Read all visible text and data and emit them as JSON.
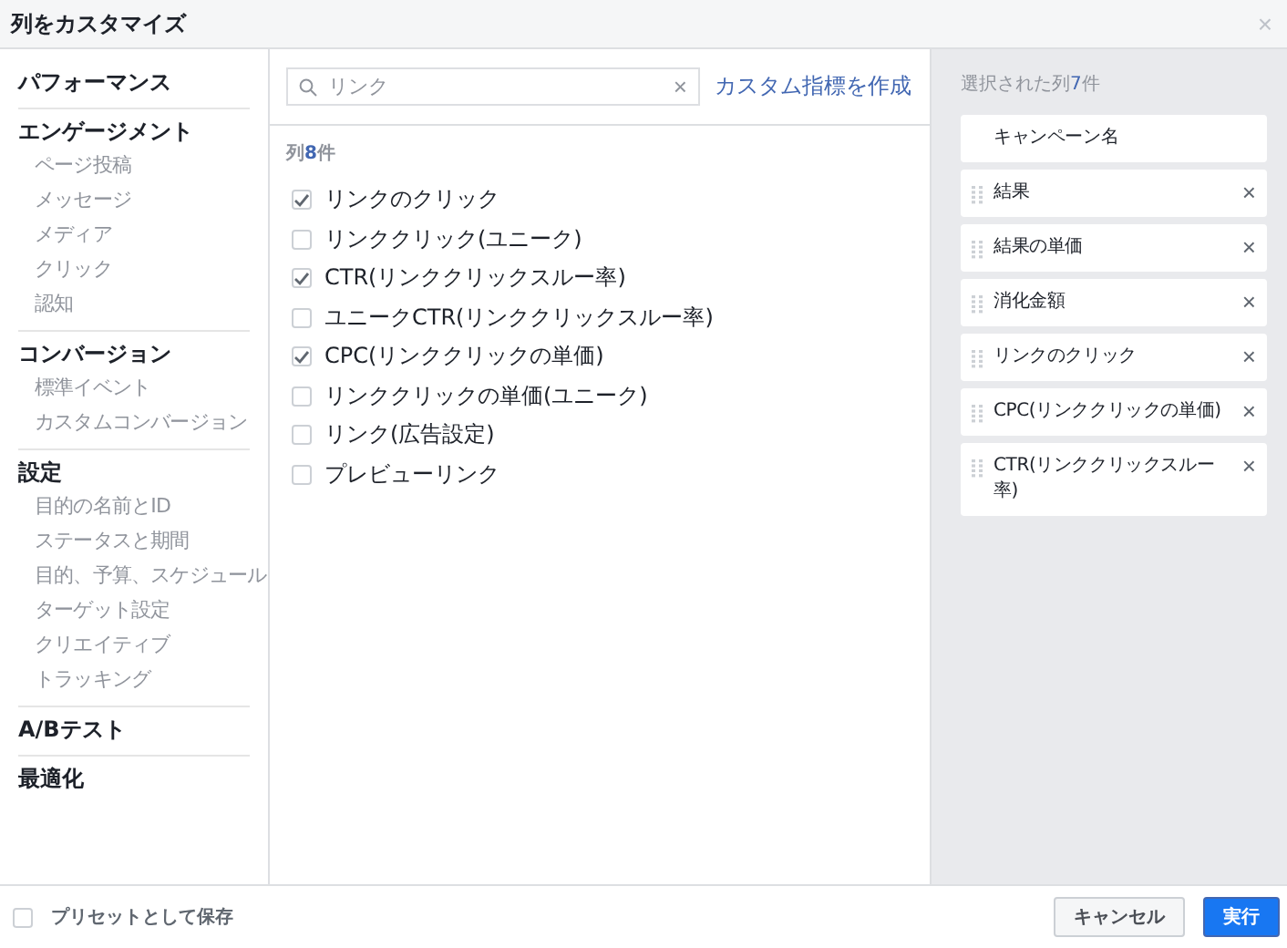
{
  "window": {
    "title": "列をカスタマイズ",
    "close": "×"
  },
  "sidebar": {
    "groups": [
      {
        "heading": "パフォーマンス"
      },
      {
        "heading": "エンゲージメント",
        "items": [
          "ページ投稿",
          "メッセージ",
          "メディア",
          "クリック",
          "認知"
        ]
      },
      {
        "heading": "コンバージョン",
        "items": [
          "標準イベント",
          "カスタムコンバージョン"
        ]
      },
      {
        "heading": "設定",
        "items": [
          "目的の名前とID",
          "ステータスと期間",
          "目的、予算、スケジュール",
          "ターゲット設定",
          "クリエイティブ",
          "トラッキング"
        ]
      },
      {
        "heading": "A/Bテスト"
      },
      {
        "heading": "最適化"
      }
    ]
  },
  "search": {
    "value": "リンク",
    "clear": "×"
  },
  "create_link": "カスタム指標を作成",
  "results": {
    "label": "列",
    "count": "8",
    "unit": "件",
    "items": [
      {
        "label": "リンクのクリック",
        "checked": true
      },
      {
        "label": "リンククリック(ユニーク)",
        "checked": false
      },
      {
        "label": "CTR(リンククリックスルー率)",
        "checked": true
      },
      {
        "label": "ユニークCTR(リンククリックスルー率)",
        "checked": false
      },
      {
        "label": "CPC(リンククリックの単価)",
        "checked": true
      },
      {
        "label": "リンククリックの単価(ユニーク)",
        "checked": false
      },
      {
        "label": "リンク(広告設定)",
        "checked": false
      },
      {
        "label": "プレビューリンク",
        "checked": false
      }
    ]
  },
  "selected": {
    "label": "選択された列",
    "count": "7",
    "unit": "件",
    "items": [
      {
        "label": "キャンペーン名",
        "kind": "fixed"
      },
      {
        "label": "結果",
        "kind": "removable"
      },
      {
        "label": "結果の単価",
        "kind": "removable"
      },
      {
        "label": "消化金額",
        "kind": "removable"
      },
      {
        "label": "リンクのクリック",
        "kind": "removable"
      },
      {
        "label": "CPC(リンククリックの単価)",
        "kind": "removable"
      },
      {
        "label": "CTR(リンククリックスルー率)",
        "kind": "removable"
      }
    ]
  },
  "footer": {
    "save_preset": {
      "label": "プリセットとして保存",
      "checked": false
    },
    "buttons": [
      {
        "label": "キャンセル",
        "kind": "secondary"
      },
      {
        "label": "実行",
        "kind": "primary"
      }
    ]
  }
}
